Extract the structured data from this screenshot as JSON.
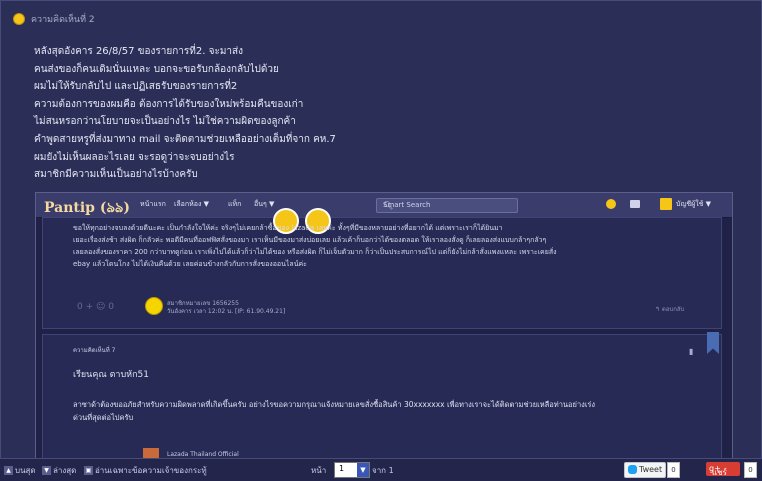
{
  "post": {
    "comment_label": "ความคิดเห็นที่ 2",
    "lines": [
      "หลังสุดอังคาร 26/8/57 ของรายการที่2. จะมาส่ง",
      "คนส่งของก็คนเดิมนั่นแหละ บอกจะขอรับกล้องกลับไปด้วย",
      "ผมไม่ให้รับกลับไป และปฏิเสธรับของรายการที่2",
      "ความต้องการของผมคือ ต้องการได้รับของใหม่พร้อมคืนของเก่า",
      "ไม่สนหรอกว่านโยบายจะเป็นอย่างไร ไม่ใช่ความผิดของลูกค้า",
      "คำพูดสายหรูที่ส่งมาทาง mail จะติดตามช่วยเหลืออย่างเต็มที่จาก คห.7",
      "ผมยังไม่เห็นผลอะไรเลย จะรอดูว่าจะจบอย่างไร",
      "สมาชิกมีความเห็นเป็นอย่างไรบ้างครับ"
    ]
  },
  "screenshot": {
    "nav": {
      "logo": "Pantip (ঌঌ)",
      "items": [
        "หน้าแรก",
        "เลือกห้อง ▼",
        "แท็ก",
        "อื่นๆ ▼"
      ],
      "search_placeholder": "Smart Search",
      "account_label": "บัญชีผู้ใช้ ▼"
    },
    "comment1": {
      "text_lines": [
        "ขอให้ทุกอย่างจบลงด้วยดีนะคะ เป็นกำลังใจให้ค่ะ                               จริงๆไม่เคยกล้าซื้อของ lazada เลยค่ะ ทั้งๆที่มีของหลายอย่างที่อยากได้ แต่เพราะเราก็ได้ยินมา",
        "เยอะเรื่องส่งช้า ส่งผิด ก็กลัวค่ะ พอดีมีคนที่ออฟฟิศสั่งของมา เราเห็นมีของมาส่งบ่อยเลย แล้วเค้าก็บอกว่าได้ของตลอด ให้เราลองสั่งดู ก็เลยลองส่งแบบกล้าๆกลัวๆ",
        "เลยลองสั่งของราคา 200 กว่าบาทดูก่อน เราเพิ่งไปได้แล้วก็ว่าไม่ได้ของ หรือส่งผิด ก็ไม่เจ็บตัวมาก ก็ว่าเป็นประสบการณ์ไป แต่ก็ยังไม่กล้าสั่งแพงแหละ เพราะเคยสั่ง",
        "ebay แล้วโดนโกง ไม่ได้เงินคืนด้วย เลยค่อนข้างกลัวกับการสั่งของออนไลน์ค่ะ"
      ],
      "member": "สมาชิกหมายเลข 1656255",
      "time": "วันอังคาร เวลา 12:02 น. [IP: 61.90.49.21]",
      "vote_plus": "+",
      "vote_count": "0",
      "reply_label": "↰ ตอบกลับ"
    },
    "comment2": {
      "title": "ความคิดเห็นที่ 7",
      "greeting": "เรียนคุณ ตาบหัก51",
      "body_line1": "ลาซาด้าต้องขออภัยสำหรับความผิดพลาดที่เกิดขึ้นครับ อย่างไรขอความกรุณาแจ้งหมายเลขสั่งซื้อสินค้า 30xxxxxxx เพื่อทางเราจะได้ติดตามช่วยเหลือท่านอย่างเร่ง",
      "body_line2": "ด่วนที่สุดต่อไปครับ",
      "signature": "Lazada Thailand Official"
    }
  },
  "bottom_bar": {
    "top_label": "บนสุด",
    "bottom_label": "ล่างสุด",
    "owner_label": "อ่านเฉพาะข้อความเจ้าของกระทู้",
    "page_label": "หน้า",
    "page_value": "1",
    "of_label": "จาก 1",
    "tweet_label": "Tweet",
    "tweet_count": "0",
    "gplus_label": "แชร์",
    "gplus_count": "0"
  },
  "colors": {
    "background": "#2b2f57",
    "text": "#e6e8f5",
    "accent": "#3a57b8"
  }
}
